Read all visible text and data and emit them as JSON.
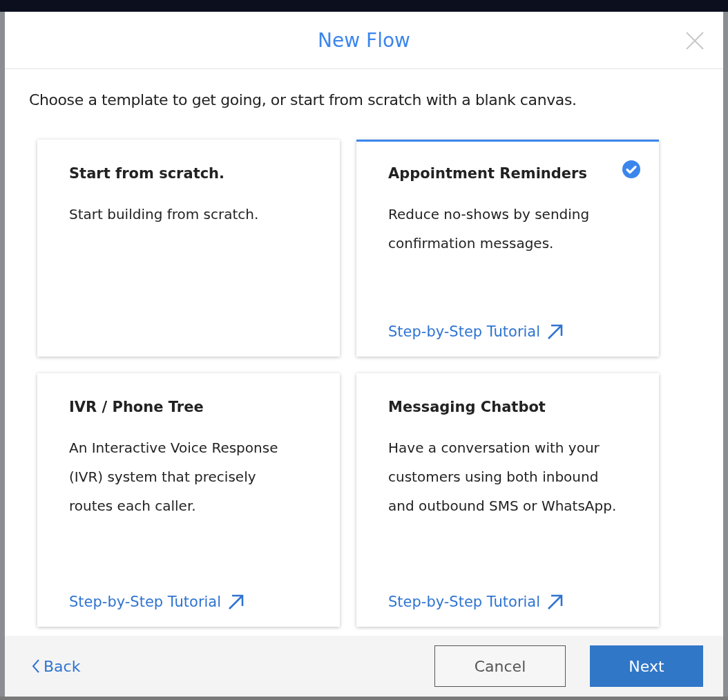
{
  "dialog": {
    "title": "New Flow",
    "intro": "Choose a template to get going, or start from scratch with a blank canvas."
  },
  "templates": [
    {
      "title": "Start from scratch.",
      "description": "Start building from scratch.",
      "selected": false
    },
    {
      "title": "Appointment Reminders",
      "description": "Reduce no-shows by sending confirmation messages.",
      "link": "Step-by-Step Tutorial",
      "selected": true
    },
    {
      "title": "IVR / Phone Tree",
      "description": "An Interactive Voice Response (IVR) system that precisely routes each caller.",
      "link": "Step-by-Step Tutorial",
      "selected": false
    },
    {
      "title": "Messaging Chatbot",
      "description": "Have a conversation with your customers using both inbound and outbound SMS or WhatsApp.",
      "link": "Step-by-Step Tutorial",
      "selected": false
    }
  ],
  "footer": {
    "back": "Back",
    "cancel": "Cancel",
    "next": "Next"
  }
}
